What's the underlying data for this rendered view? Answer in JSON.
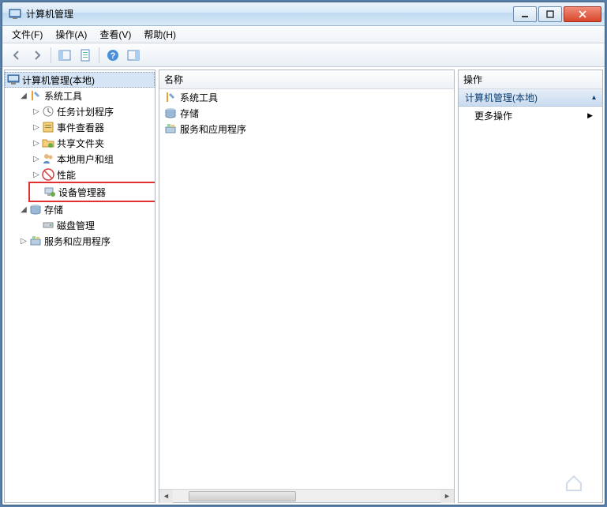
{
  "window": {
    "title": "计算机管理"
  },
  "menu": {
    "file": "文件(F)",
    "action": "操作(A)",
    "view": "查看(V)",
    "help": "帮助(H)"
  },
  "tree": {
    "root": "计算机管理(本地)",
    "system_tools": "系统工具",
    "task_scheduler": "任务计划程序",
    "event_viewer": "事件查看器",
    "shared_folders": "共享文件夹",
    "local_users": "本地用户和组",
    "performance": "性能",
    "device_manager": "设备管理器",
    "storage": "存储",
    "disk_management": "磁盘管理",
    "services": "服务和应用程序"
  },
  "middle": {
    "header": "名称",
    "items": {
      "system_tools": "系统工具",
      "storage": "存储",
      "services": "服务和应用程序"
    }
  },
  "actions": {
    "header": "操作",
    "group": "计算机管理(本地)",
    "more": "更多操作"
  },
  "icons": {
    "expanded": "◢",
    "collapsed": "▷",
    "arrow_right": "▶",
    "arrow_up": "▴"
  }
}
